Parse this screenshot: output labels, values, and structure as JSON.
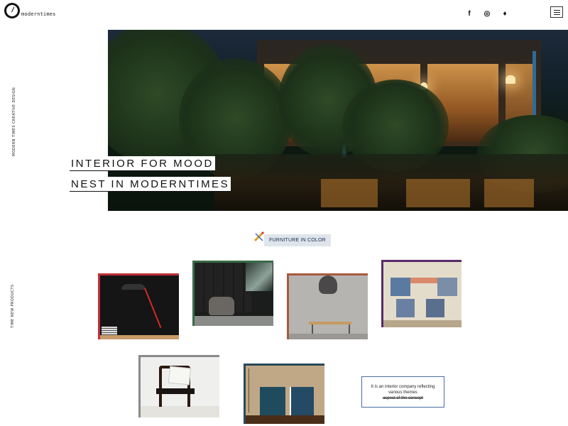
{
  "brand": {
    "name": "moderntimes"
  },
  "social": [
    {
      "name": "facebook-icon",
      "glyph": "f"
    },
    {
      "name": "instagram-icon",
      "glyph": "◎"
    },
    {
      "name": "twitter-icon",
      "glyph": "♦"
    }
  ],
  "menu": {
    "icon": "hamburger-menu-icon"
  },
  "side_text": {
    "top": "MODERN TIMES CREATIVE DESIGN",
    "bottom": "TIME NEW PRODUCTS"
  },
  "hero": {
    "line1": "INTERIOR FOR MOOD",
    "line2": "NEST IN MODERNTIMES"
  },
  "section": {
    "label": "FURNITURE IN COLOR",
    "icon": "pencil-icon"
  },
  "products": [
    {
      "id": "lamp",
      "accent": "#c0303a"
    },
    {
      "id": "lounge-chair",
      "accent": "#3a6a4a"
    },
    {
      "id": "dining-table",
      "accent": "#a85a40"
    },
    {
      "id": "shelving",
      "accent": "#5a2a6a"
    },
    {
      "id": "wood-chair",
      "accent": "#8a8a8a"
    },
    {
      "id": "drawers",
      "accent": "#2a4a5a"
    }
  ],
  "about": {
    "line1": "It is an interior company reflecting",
    "line2": "various themes",
    "line3": "aspect of the concept"
  }
}
